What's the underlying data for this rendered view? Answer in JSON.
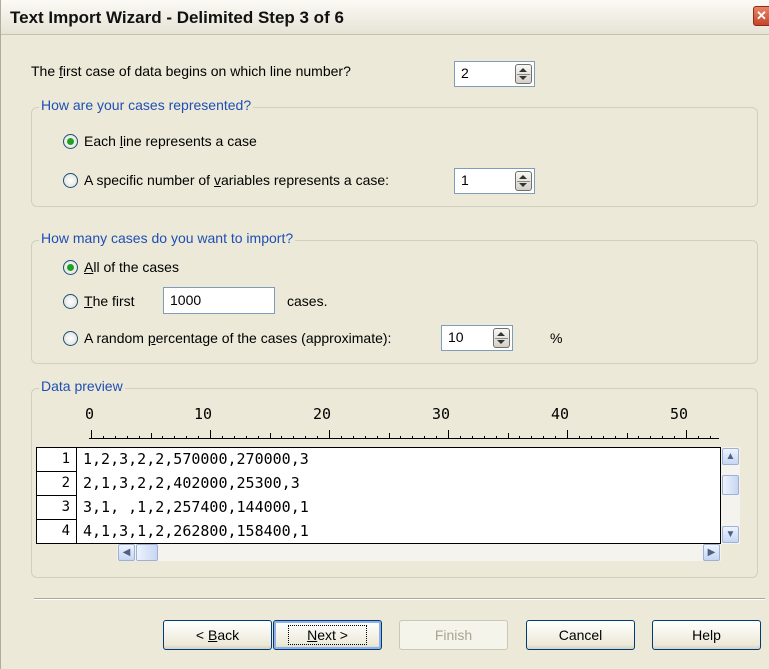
{
  "window": {
    "title": "Text Import Wizard - Delimited Step 3 of 6",
    "close_glyph": "✕"
  },
  "first_case": {
    "label_pre": "The ",
    "label_ul": "f",
    "label_post": "irst case of data begins on which line number?",
    "value": "2"
  },
  "cases_group": {
    "legend": "How are your cases represented?",
    "option1_pre": "Each ",
    "option1_ul": "l",
    "option1_post": "ine represents a case",
    "option1_selected": true,
    "option2_pre": "A specific number of ",
    "option2_ul": "v",
    "option2_post": "ariables represents a case:",
    "option2_value": "1"
  },
  "import_group": {
    "legend": "How many cases do you want to import?",
    "all_ul": "A",
    "all_post": "ll of the cases",
    "first_ul": "T",
    "first_post": "he first",
    "first_value": "1000",
    "first_suffix": "cases.",
    "random_pre": "A random ",
    "random_ul": "p",
    "random_post": "ercentage of the cases (approximate):",
    "random_value": "10",
    "random_suffix": "%"
  },
  "preview": {
    "legend": "Data preview",
    "ruler": [
      "0",
      "10",
      "20",
      "30",
      "40",
      "50"
    ],
    "rows": [
      {
        "num": "1",
        "text": "1,2,3,2,2,570000,270000,3"
      },
      {
        "num": "2",
        "text": "2,1,3,2,2,402000,25300,3"
      },
      {
        "num": "3",
        "text": "3,1, ,1,2,257400,144000,1"
      },
      {
        "num": "4",
        "text": "4,1,3,1,2,262800,158400,1"
      }
    ]
  },
  "buttons": {
    "back_pre": "< ",
    "back_ul": "B",
    "back_post": "ack",
    "next_ul": "N",
    "next_post": "ext >",
    "finish": "Finish",
    "cancel": "Cancel",
    "help": "Help"
  },
  "colors": {
    "dialog_bg": "#ece9d8",
    "group_legend": "#1f4fb4",
    "radio_selected": "#21a121"
  }
}
